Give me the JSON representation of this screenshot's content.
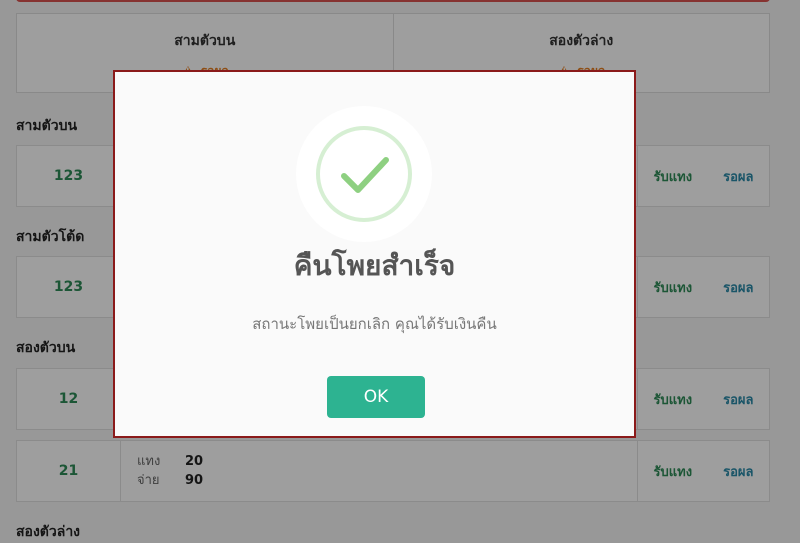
{
  "summary": {
    "cells": [
      {
        "title": "สามตัวบน",
        "status": "รอผล"
      },
      {
        "title": "สองตัวล่าง",
        "status": "รอผล"
      }
    ]
  },
  "sections": [
    {
      "title": "สามตัวบน",
      "rows": [
        {
          "number": "123",
          "action": "รับแทง",
          "status": "รอผล"
        }
      ]
    },
    {
      "title": "สามตัวโต้ด",
      "rows": [
        {
          "number": "123",
          "action": "รับแทง",
          "status": "รอผล"
        }
      ]
    },
    {
      "title": "สองตัวบน",
      "rows": [
        {
          "number": "12",
          "action": "รับแทง",
          "status": "รอผล"
        },
        {
          "number": "21",
          "bet_label": "แทง",
          "bet": "20",
          "pay_label": "จ่าย",
          "pay": "90",
          "action": "รับแทง",
          "status": "รอผล"
        }
      ]
    },
    {
      "title": "สองตัวล่าง"
    }
  ],
  "modal": {
    "title": "คืนโพยสำเร็จ",
    "text": "สถานะโพยเป็นยกเลิก คุณได้รับเงินคืน",
    "ok_label": "OK"
  },
  "colors": {
    "success": "#8ed081",
    "ok_button": "#2db391",
    "warning": "#e67e22"
  }
}
